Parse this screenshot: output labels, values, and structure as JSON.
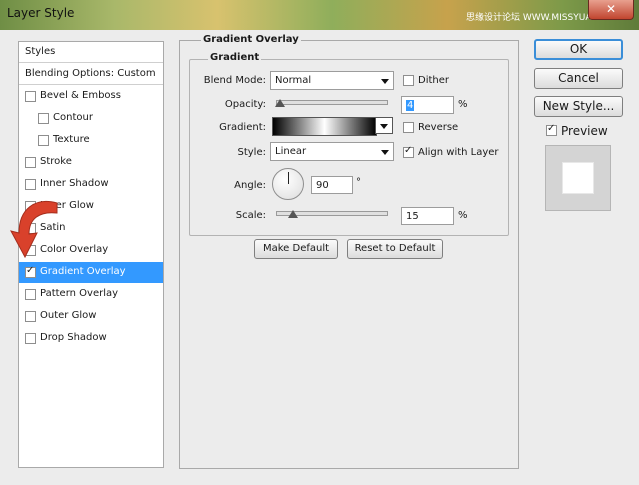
{
  "window": {
    "title": "Layer Style",
    "watermark": "思缘设计论坛 WWW.MISSYUAN.COM",
    "close_glyph": "✕"
  },
  "sidebar": {
    "header": "Styles",
    "blending": "Blending Options: Custom",
    "items": [
      {
        "label": "Bevel & Emboss",
        "checked": false
      },
      {
        "label": "Contour",
        "checked": false
      },
      {
        "label": "Texture",
        "checked": false
      },
      {
        "label": "Stroke",
        "checked": false
      },
      {
        "label": "Inner Shadow",
        "checked": false
      },
      {
        "label": "Inner Glow",
        "checked": false
      },
      {
        "label": "Satin",
        "checked": false
      },
      {
        "label": "Color Overlay",
        "checked": false
      },
      {
        "label": "Gradient Overlay",
        "checked": true,
        "selected": true
      },
      {
        "label": "Pattern Overlay",
        "checked": false
      },
      {
        "label": "Outer Glow",
        "checked": false
      },
      {
        "label": "Drop Shadow",
        "checked": false
      }
    ]
  },
  "panel": {
    "section": "Gradient Overlay",
    "group": "Gradient",
    "blend_mode": {
      "label": "Blend Mode:",
      "value": "Normal"
    },
    "dither": {
      "label": "Dither",
      "checked": false
    },
    "opacity": {
      "label": "Opacity:",
      "value": "4",
      "unit": "%",
      "level_percent": 4
    },
    "gradient": {
      "label": "Gradient:",
      "colors": [
        "#000000",
        "#ffffff",
        "#000000"
      ]
    },
    "reverse": {
      "label": "Reverse",
      "checked": false
    },
    "style": {
      "label": "Style:",
      "value": "Linear"
    },
    "align": {
      "label": "Align with Layer",
      "checked": true
    },
    "angle": {
      "label": "Angle:",
      "value": "90",
      "unit": "°"
    },
    "scale": {
      "label": "Scale:",
      "value": "15",
      "unit": "%",
      "level_percent": 15
    },
    "make_default": "Make Default",
    "reset_default": "Reset to Default"
  },
  "actions": {
    "ok": "OK",
    "cancel": "Cancel",
    "new_style": "New Style...",
    "preview": {
      "label": "Preview",
      "checked": true
    }
  },
  "colors": {
    "selection": "#3399ff",
    "annotation_arrow": "#d9412b",
    "ok_border": "#3a8ed8"
  },
  "icons": [
    "close-icon",
    "dropdown-arrow-icon",
    "checkmark-icon",
    "slider-thumb-icon",
    "angle-dial-icon",
    "annotation-arrow-icon"
  ]
}
